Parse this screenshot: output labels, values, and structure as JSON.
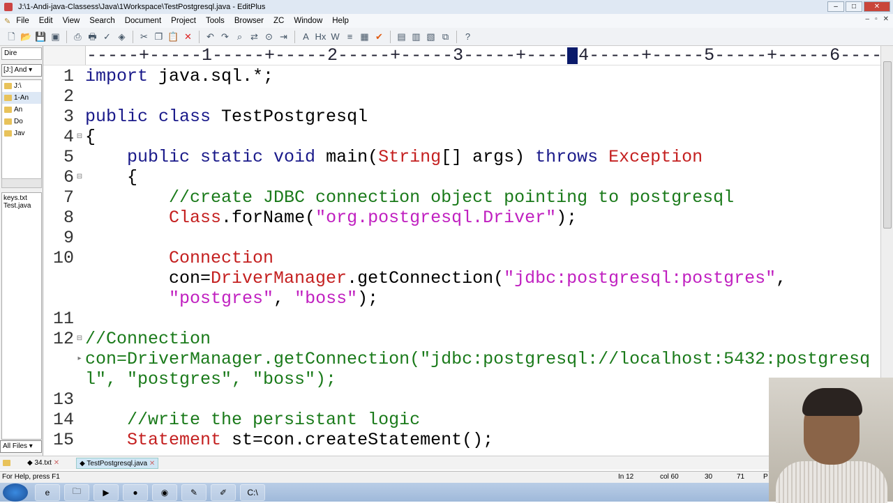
{
  "window": {
    "title": "J:\\1-Andi-java-Classess\\Java\\1Workspace\\TestPostgresql.java - EditPlus"
  },
  "menu": [
    "File",
    "Edit",
    "View",
    "Search",
    "Document",
    "Project",
    "Tools",
    "Browser",
    "ZC",
    "Window",
    "Help"
  ],
  "toolbar": [
    "new-file",
    "open",
    "save",
    "save-all",
    "print-preview",
    "print",
    "spell-check",
    "browser-preview",
    "cut",
    "copy",
    "paste",
    "delete",
    "undo",
    "redo",
    "find",
    "replace",
    "find-in-files",
    "goto-line",
    "font",
    "hex",
    "word-wrap",
    "line-numbers",
    "column-select",
    "check",
    "cliptext",
    "directory",
    "output",
    "fullscreen",
    "help"
  ],
  "left_panel": {
    "tab": "Dire",
    "drive": "[J:] And",
    "tree": [
      "J:\\",
      "1-An",
      "An",
      "Do",
      "Jav"
    ],
    "files": [
      "keys.txt",
      "Test.java"
    ],
    "filter": "All Files"
  },
  "ruler": {
    "text": "-----+-----1-----+-----2-----+-----3-----+-----4-----+-----5-----+-----6-----+-----7-----+--"
  },
  "editor": {
    "lines": [
      {
        "n": "1",
        "fold": "",
        "tokens": [
          {
            "c": "kw",
            "t": "import"
          },
          {
            "c": "plain",
            "t": " java.sql.*;"
          }
        ]
      },
      {
        "n": "2",
        "fold": "",
        "tokens": []
      },
      {
        "n": "3",
        "fold": "",
        "tokens": [
          {
            "c": "kw",
            "t": "public class"
          },
          {
            "c": "plain",
            "t": " TestPostgresql"
          }
        ]
      },
      {
        "n": "4",
        "fold": "⊟",
        "tokens": [
          {
            "c": "plain",
            "t": "{"
          }
        ]
      },
      {
        "n": "5",
        "fold": "",
        "tokens": [
          {
            "c": "plain",
            "t": "    "
          },
          {
            "c": "kw",
            "t": "public static void"
          },
          {
            "c": "plain",
            "t": " main("
          },
          {
            "c": "ty",
            "t": "String"
          },
          {
            "c": "plain",
            "t": "[] args) "
          },
          {
            "c": "kw",
            "t": "throws"
          },
          {
            "c": "plain",
            "t": " "
          },
          {
            "c": "ty",
            "t": "Exception"
          }
        ]
      },
      {
        "n": "6",
        "fold": "⊟",
        "tokens": [
          {
            "c": "plain",
            "t": "    {"
          }
        ]
      },
      {
        "n": "7",
        "fold": "",
        "tokens": [
          {
            "c": "cm",
            "t": "        //create JDBC connection object pointing to postgresql"
          }
        ]
      },
      {
        "n": "8",
        "fold": "",
        "tokens": [
          {
            "c": "plain",
            "t": "        "
          },
          {
            "c": "ty",
            "t": "Class"
          },
          {
            "c": "plain",
            "t": ".forName("
          },
          {
            "c": "str",
            "t": "\"org.postgresql.Driver\""
          },
          {
            "c": "plain",
            "t": ");"
          }
        ]
      },
      {
        "n": "9",
        "fold": "",
        "tokens": []
      },
      {
        "n": "10",
        "fold": "",
        "tokens": [
          {
            "c": "plain",
            "t": "        "
          },
          {
            "c": "ty",
            "t": "Connection"
          }
        ]
      },
      {
        "n": "",
        "fold": "",
        "tokens": [
          {
            "c": "plain",
            "t": "        con="
          },
          {
            "c": "ty",
            "t": "DriverManager"
          },
          {
            "c": "plain",
            "t": ".getConnection("
          },
          {
            "c": "str",
            "t": "\"jdbc:postgresql:postgres\""
          },
          {
            "c": "plain",
            "t": ","
          }
        ]
      },
      {
        "n": "",
        "fold": "",
        "tokens": [
          {
            "c": "plain",
            "t": "        "
          },
          {
            "c": "str",
            "t": "\"postgres\""
          },
          {
            "c": "plain",
            "t": ", "
          },
          {
            "c": "str",
            "t": "\"boss\""
          },
          {
            "c": "plain",
            "t": ");"
          }
        ]
      },
      {
        "n": "11",
        "fold": "",
        "tokens": []
      },
      {
        "n": "12",
        "fold": "⊟",
        "tokens": [
          {
            "c": "cm",
            "t": "//Connection"
          }
        ]
      },
      {
        "n": "",
        "fold": "▸",
        "tokens": [
          {
            "c": "cm",
            "t": "con=DriverManager.getConnection(\"jdbc:postgresql://localhost:5432:postgresq"
          }
        ]
      },
      {
        "n": "",
        "fold": "",
        "tokens": [
          {
            "c": "cm",
            "t": "l\", \"postgres\", \"boss\");"
          }
        ]
      },
      {
        "n": "13",
        "fold": "",
        "tokens": []
      },
      {
        "n": "14",
        "fold": "",
        "tokens": [
          {
            "c": "cm",
            "t": "    //write the persistant logic"
          }
        ]
      },
      {
        "n": "15",
        "fold": "",
        "tokens": [
          {
            "c": "plain",
            "t": "    "
          },
          {
            "c": "ty",
            "t": "Statement"
          },
          {
            "c": "plain",
            "t": " st=con.createStatement();"
          }
        ]
      }
    ]
  },
  "tabs": [
    {
      "label": "34.txt",
      "active": false
    },
    {
      "label": "TestPostgresql.java",
      "active": true
    }
  ],
  "status": {
    "help": "For Help, press F1",
    "line": "In 12",
    "col": "col 60",
    "n1": "30",
    "n2": "71",
    "mode": "P"
  },
  "taskbar": [
    "ie",
    "explorer",
    "media-player",
    "firefox",
    "chrome",
    "notepad",
    "editplus",
    "cmd"
  ],
  "colors": {
    "keyword": "#1a1a8a",
    "type": "#c42020",
    "string": "#c020c0",
    "comment": "#1a7a1a"
  }
}
